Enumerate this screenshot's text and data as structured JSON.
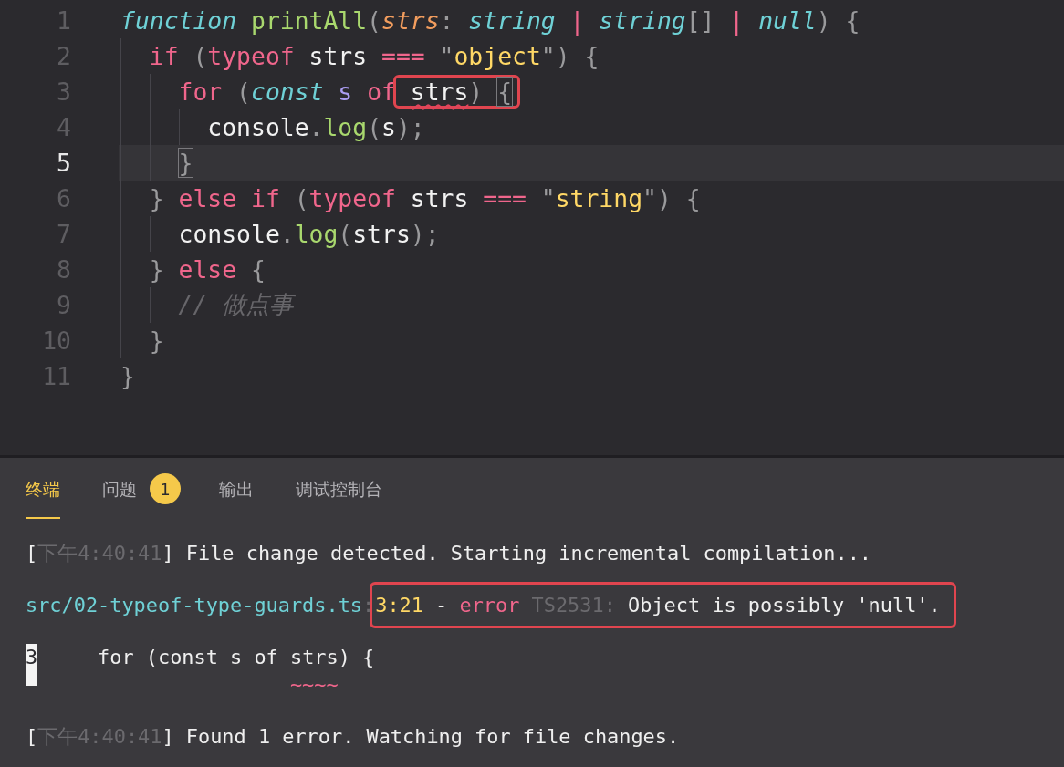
{
  "editor": {
    "lines": [
      {
        "number": "1",
        "current": false,
        "tokens": [
          {
            "kind": "storage",
            "text": "function "
          },
          {
            "kind": "function",
            "text": "printAll"
          },
          {
            "kind": "punct",
            "text": "("
          },
          {
            "kind": "param",
            "text": "strs"
          },
          {
            "kind": "punct",
            "text": ": "
          },
          {
            "kind": "storage",
            "text": "string"
          },
          {
            "kind": "operator",
            "text": " | "
          },
          {
            "kind": "storage",
            "text": "string"
          },
          {
            "kind": "punct",
            "text": "[]"
          },
          {
            "kind": "operator",
            "text": " | "
          },
          {
            "kind": "storage",
            "text": "null"
          },
          {
            "kind": "punct",
            "text": ") {"
          }
        ]
      },
      {
        "number": "2",
        "current": false,
        "tokens": [
          {
            "kind": "keyword",
            "text": "  if "
          },
          {
            "kind": "punct",
            "text": "("
          },
          {
            "kind": "keyword",
            "text": "typeof"
          },
          {
            "kind": "plain",
            "text": " strs "
          },
          {
            "kind": "operator",
            "text": "==="
          },
          {
            "kind": "punct",
            "text": " \""
          },
          {
            "kind": "string",
            "text": "object"
          },
          {
            "kind": "punct",
            "text": "\") {"
          }
        ]
      },
      {
        "number": "3",
        "current": false,
        "tokens": [
          {
            "kind": "keyword",
            "text": "    for "
          },
          {
            "kind": "punct",
            "text": "("
          },
          {
            "kind": "storage",
            "text": "const"
          },
          {
            "kind": "variable",
            "text": " s "
          },
          {
            "kind": "keyword",
            "text": "of"
          },
          {
            "kind": "box",
            "tokens": [
              {
                "kind": "plain",
                "text": " strs",
                "error": true
              },
              {
                "kind": "punct",
                "text": ") "
              },
              {
                "kind": "punct",
                "text": "{",
                "matched": true
              }
            ]
          }
        ]
      },
      {
        "number": "4",
        "current": false,
        "tokens": [
          {
            "kind": "plain",
            "text": "      console"
          },
          {
            "kind": "punct",
            "text": "."
          },
          {
            "kind": "function",
            "text": "log"
          },
          {
            "kind": "punct",
            "text": "("
          },
          {
            "kind": "plain",
            "text": "s"
          },
          {
            "kind": "punct",
            "text": ");"
          }
        ]
      },
      {
        "number": "5",
        "current": true,
        "tokens": [
          {
            "kind": "punct",
            "text": "    }",
            "matched": true
          }
        ]
      },
      {
        "number": "6",
        "current": false,
        "tokens": [
          {
            "kind": "punct",
            "text": "  } "
          },
          {
            "kind": "keyword",
            "text": "else if "
          },
          {
            "kind": "punct",
            "text": "("
          },
          {
            "kind": "keyword",
            "text": "typeof"
          },
          {
            "kind": "plain",
            "text": " strs "
          },
          {
            "kind": "operator",
            "text": "==="
          },
          {
            "kind": "punct",
            "text": " \""
          },
          {
            "kind": "string",
            "text": "string"
          },
          {
            "kind": "punct",
            "text": "\") {"
          }
        ]
      },
      {
        "number": "7",
        "current": false,
        "tokens": [
          {
            "kind": "plain",
            "text": "    console"
          },
          {
            "kind": "punct",
            "text": "."
          },
          {
            "kind": "function",
            "text": "log"
          },
          {
            "kind": "punct",
            "text": "("
          },
          {
            "kind": "plain",
            "text": "strs"
          },
          {
            "kind": "punct",
            "text": ");"
          }
        ]
      },
      {
        "number": "8",
        "current": false,
        "tokens": [
          {
            "kind": "punct",
            "text": "  } "
          },
          {
            "kind": "keyword",
            "text": "else "
          },
          {
            "kind": "punct",
            "text": "{"
          }
        ]
      },
      {
        "number": "9",
        "current": false,
        "tokens": [
          {
            "kind": "comment",
            "text": "    // 做点事"
          }
        ]
      },
      {
        "number": "10",
        "current": false,
        "tokens": [
          {
            "kind": "punct",
            "text": "  }"
          }
        ]
      },
      {
        "number": "11",
        "current": false,
        "tokens": [
          {
            "kind": "punct",
            "text": "}"
          }
        ]
      }
    ]
  },
  "panel": {
    "tabs": [
      {
        "label": "终端",
        "selected": true
      },
      {
        "label": "问题",
        "selected": false,
        "badge": "1"
      },
      {
        "label": "输出",
        "selected": false
      },
      {
        "label": "调试控制台",
        "selected": false
      }
    ],
    "terminal": [
      {
        "kind": "log",
        "segments": [
          {
            "kind": "plain",
            "text": "["
          },
          {
            "kind": "time",
            "text": "下午4:40:41"
          },
          {
            "kind": "plain",
            "text": "] File change detected. Starting incremental compilation..."
          }
        ]
      },
      {
        "kind": "log",
        "segments": [
          {
            "kind": "path",
            "text": "src/02-typeof-type-guards.ts"
          },
          {
            "kind": "time",
            "text": ":"
          },
          {
            "kind": "box",
            "tokens": [
              {
                "kind": "location",
                "text": "3:21"
              },
              {
                "kind": "plain",
                "text": " - "
              },
              {
                "kind": "error",
                "text": "error"
              },
              {
                "kind": "time",
                "text": " TS2531:"
              },
              {
                "kind": "plain",
                "text": " Object is possibly 'null'."
              }
            ]
          }
        ]
      },
      {
        "kind": "source",
        "segments": [
          {
            "kind": "line-number",
            "text": "3"
          },
          {
            "kind": "plain",
            "text": "     for (const s of strs) {"
          }
        ]
      },
      {
        "kind": "marker",
        "segments": [
          {
            "kind": "squiggle",
            "text": "                      ~~~~"
          }
        ]
      },
      {
        "kind": "log",
        "segments": [
          {
            "kind": "plain",
            "text": "["
          },
          {
            "kind": "time",
            "text": "下午4:40:41"
          },
          {
            "kind": "plain",
            "text": "] Found 1 error. Watching for file changes."
          }
        ]
      }
    ]
  }
}
